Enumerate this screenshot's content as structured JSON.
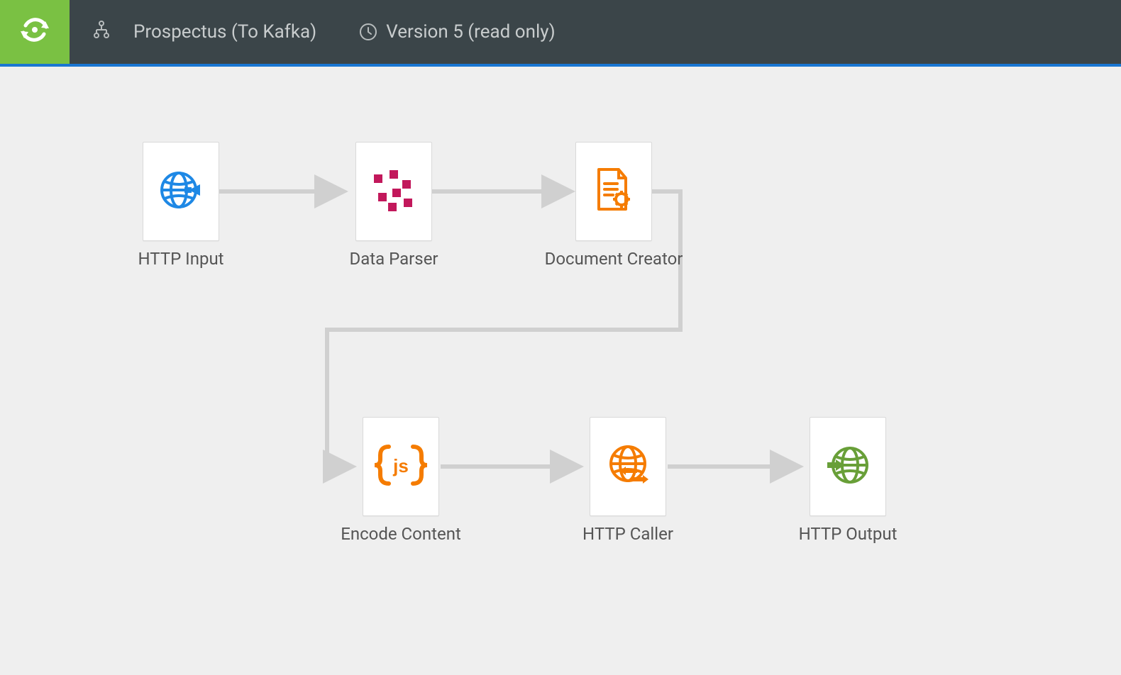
{
  "header": {
    "title": "Prospectus (To Kafka)",
    "version_label": "Version 5 (read only)"
  },
  "nodes": {
    "http_input": {
      "label": "HTTP Input",
      "icon": "globe-arrow-blue"
    },
    "data_parser": {
      "label": "Data Parser",
      "icon": "parser-magenta"
    },
    "document_creator": {
      "label": "Document Creator",
      "icon": "document-gear-orange"
    },
    "encode_content": {
      "label": "Encode Content",
      "icon": "js-braces-orange"
    },
    "http_caller": {
      "label": "HTTP Caller",
      "icon": "globe-arrows-orange"
    },
    "http_output": {
      "label": "HTTP Output",
      "icon": "globe-arrow-green"
    }
  },
  "flow": [
    [
      "http_input",
      "data_parser"
    ],
    [
      "data_parser",
      "document_creator"
    ],
    [
      "document_creator",
      "encode_content"
    ],
    [
      "encode_content",
      "http_caller"
    ],
    [
      "http_caller",
      "http_output"
    ]
  ],
  "colors": {
    "header_bg": "#3b4549",
    "accent_green": "#7ac143",
    "canvas_border": "#1976d2",
    "arrow": "#d0d0d0"
  }
}
